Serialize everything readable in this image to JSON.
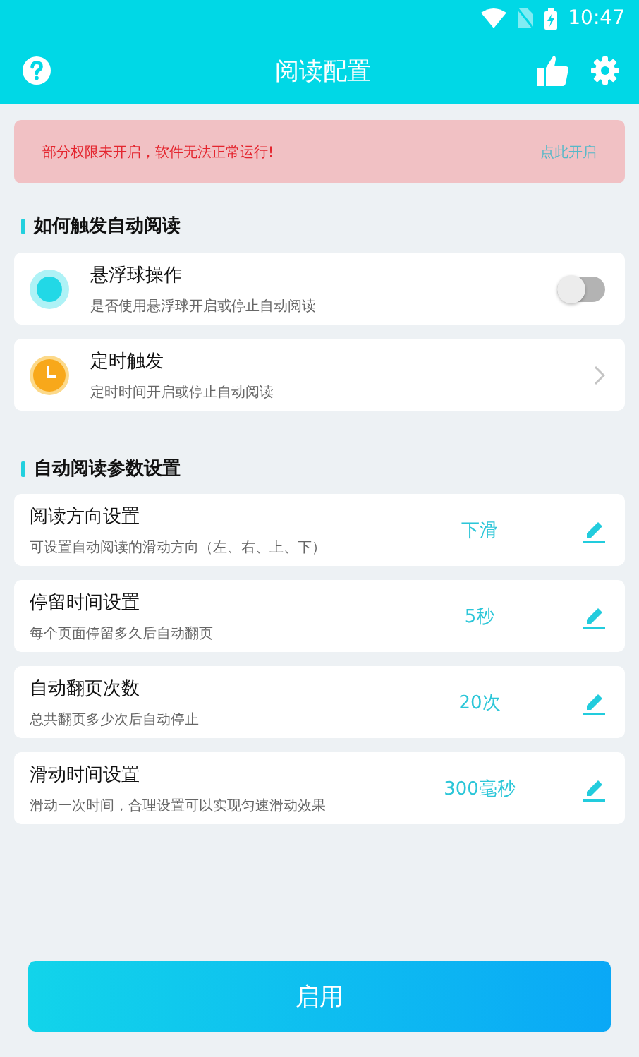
{
  "status_bar": {
    "time": "10:47"
  },
  "app_bar": {
    "title": "阅读配置"
  },
  "alert": {
    "message": "部分权限未开启，软件无法正常运行!",
    "action": "点此开启"
  },
  "trigger_section": {
    "title": "如何触发自动阅读",
    "items": [
      {
        "kind": "toggle",
        "title": "悬浮球操作",
        "subtitle": "是否使用悬浮球开启或停止自动阅读",
        "on": false
      },
      {
        "kind": "link",
        "title": "定时触发",
        "subtitle": "定时时间开启或停止自动阅读"
      }
    ]
  },
  "params_section": {
    "title": "自动阅读参数设置",
    "items": [
      {
        "title": "阅读方向设置",
        "subtitle": "可设置自动阅读的滑动方向（左、右、上、下）",
        "value": "下滑"
      },
      {
        "title": "停留时间设置",
        "subtitle": "每个页面停留多久后自动翻页",
        "value": "5秒"
      },
      {
        "title": "自动翻页次数",
        "subtitle": "总共翻页多少次后自动停止",
        "value": "20次"
      },
      {
        "title": "滑动时间设置",
        "subtitle": "滑动一次时间，合理设置可以实现匀速滑动效果",
        "value": "300毫秒"
      }
    ]
  },
  "primary_button": {
    "label": "启用"
  }
}
